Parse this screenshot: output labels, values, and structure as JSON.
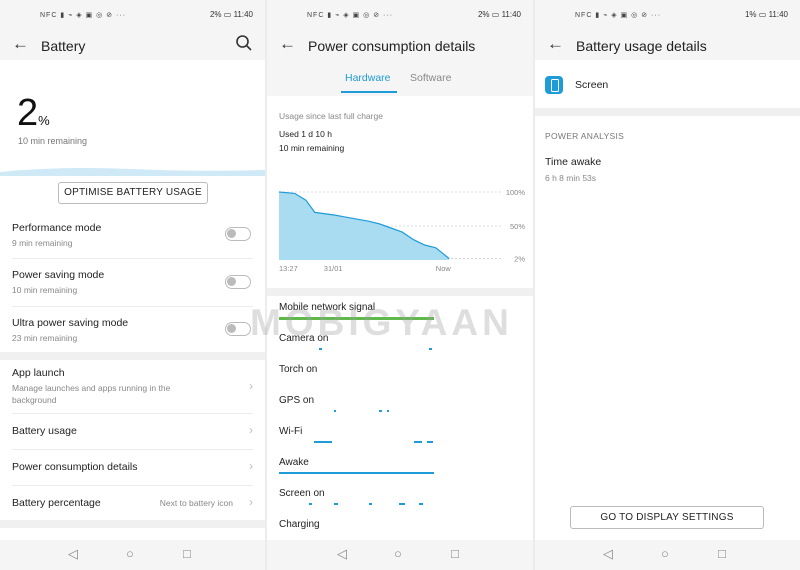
{
  "status": {
    "icons": "NFC ▮ ⌁ ◈ ▣ ◎ ⊘ ···",
    "panel1_battery": "2%",
    "panel1_time": "11:40",
    "panel2_battery": "2%",
    "panel2_time": "11:40",
    "panel3_battery": "1%",
    "panel3_time": "11:40"
  },
  "battery_screen": {
    "title": "Battery",
    "percent_value": "2",
    "percent_sign": "%",
    "remaining": "10 min remaining",
    "optimise_button": "OPTIMISE BATTERY USAGE",
    "rows": [
      {
        "title": "Performance mode",
        "sub": "9 min remaining"
      },
      {
        "title": "Power saving mode",
        "sub": "10 min remaining"
      },
      {
        "title": "Ultra power saving mode",
        "sub": "23 min remaining"
      },
      {
        "title": "App launch",
        "sub": "Manage launches and apps running in the background"
      },
      {
        "title": "Battery usage"
      },
      {
        "title": "Power consumption details"
      },
      {
        "title": "Battery percentage",
        "value": "Next to battery icon"
      }
    ]
  },
  "power_screen": {
    "title": "Power consumption details",
    "tab_hardware": "Hardware",
    "tab_software": "Software",
    "since": "Usage since last full charge",
    "used": "Used 1 d 10 h",
    "remaining": "10 min remaining",
    "categories": [
      "Mobile network signal",
      "Camera on",
      "Torch on",
      "GPS on",
      "Wi-Fi",
      "Awake",
      "Screen on",
      "Charging"
    ]
  },
  "usage_screen": {
    "title": "Battery usage details",
    "item": "Screen",
    "section": "POWER ANALYSIS",
    "time_awake_label": "Time awake",
    "time_awake_value": "6 h 8 min 53s",
    "display_button": "GO TO DISPLAY SETTINGS"
  },
  "chart_data": {
    "type": "area",
    "title": "",
    "x_tick_labels": [
      "13:27",
      "31/01",
      "Now"
    ],
    "y_tick_labels": [
      "100%",
      "50%",
      "2%"
    ],
    "x": [
      0,
      0.07,
      0.12,
      0.16,
      0.25,
      0.3,
      0.35,
      0.4,
      0.45,
      0.5,
      0.55,
      0.6,
      0.65,
      0.7,
      0.73,
      0.76
    ],
    "y": [
      100,
      98,
      88,
      70,
      66,
      63,
      60,
      57,
      53,
      47,
      41,
      30,
      22,
      18,
      10,
      2
    ],
    "ylim": [
      0,
      100
    ],
    "color": "#1e9cd7",
    "fill": "#a9dcf1"
  },
  "watermark": "MOBIGYAAN",
  "colors": {
    "accent": "#1e9cd7",
    "wave": "#cfe9f6",
    "bar": "#1e9cd7",
    "signal": "#5fb84a"
  },
  "navbar": {
    "back": "◁",
    "home": "○",
    "recent": "□"
  }
}
